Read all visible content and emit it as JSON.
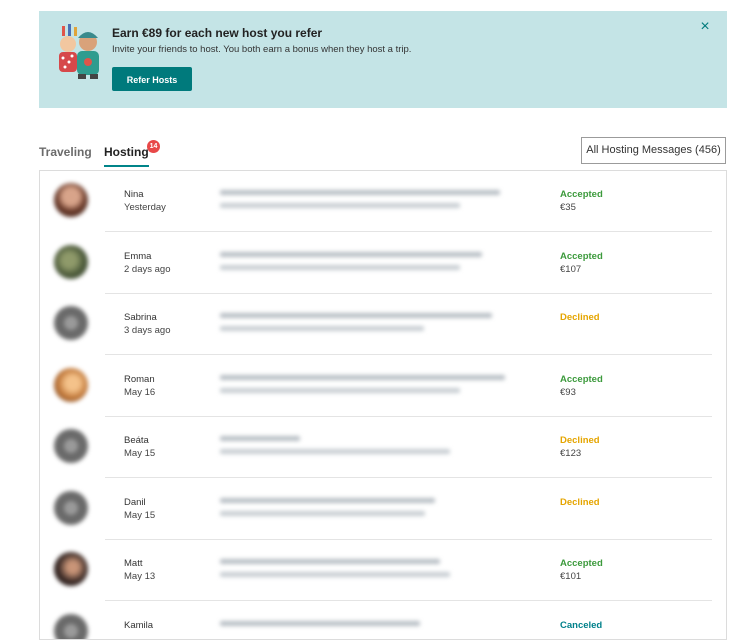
{
  "banner": {
    "title": "Earn €89 for each new host you refer",
    "subtitle": "Invite your friends to host. You both earn a bonus when they host a trip.",
    "button_label": "Refer Hosts",
    "close_icon": "×"
  },
  "tabs": {
    "traveling": "Traveling",
    "hosting": "Hosting",
    "hosting_badge": "14"
  },
  "all_messages_label": "All Hosting Messages (456)",
  "colors": {
    "accent": "#007a7c",
    "accepted": "#3c9a3c",
    "declined": "#e5a500",
    "canceled": "#00808a",
    "badge": "#e84848"
  },
  "messages": [
    {
      "name": "Nina",
      "date": "Yesterday",
      "status": "Accepted",
      "status_type": "accepted",
      "price": "€35"
    },
    {
      "name": "Emma",
      "date": "2 days ago",
      "status": "Accepted",
      "status_type": "accepted",
      "price": "€107"
    },
    {
      "name": "Sabrina",
      "date": "3 days ago",
      "status": "Declined",
      "status_type": "declined",
      "price": ""
    },
    {
      "name": "Roman",
      "date": "May 16",
      "status": "Accepted",
      "status_type": "accepted",
      "price": "€93"
    },
    {
      "name": "Beáta",
      "date": "May 15",
      "status": "Declined",
      "status_type": "declined",
      "price": "€123"
    },
    {
      "name": "Danil",
      "date": "May 15",
      "status": "Declined",
      "status_type": "declined",
      "price": ""
    },
    {
      "name": "Matt",
      "date": "May 13",
      "status": "Accepted",
      "status_type": "accepted",
      "price": "€101"
    },
    {
      "name": "Kamila",
      "date": "",
      "status": "Canceled",
      "status_type": "canceled",
      "price": ""
    }
  ]
}
